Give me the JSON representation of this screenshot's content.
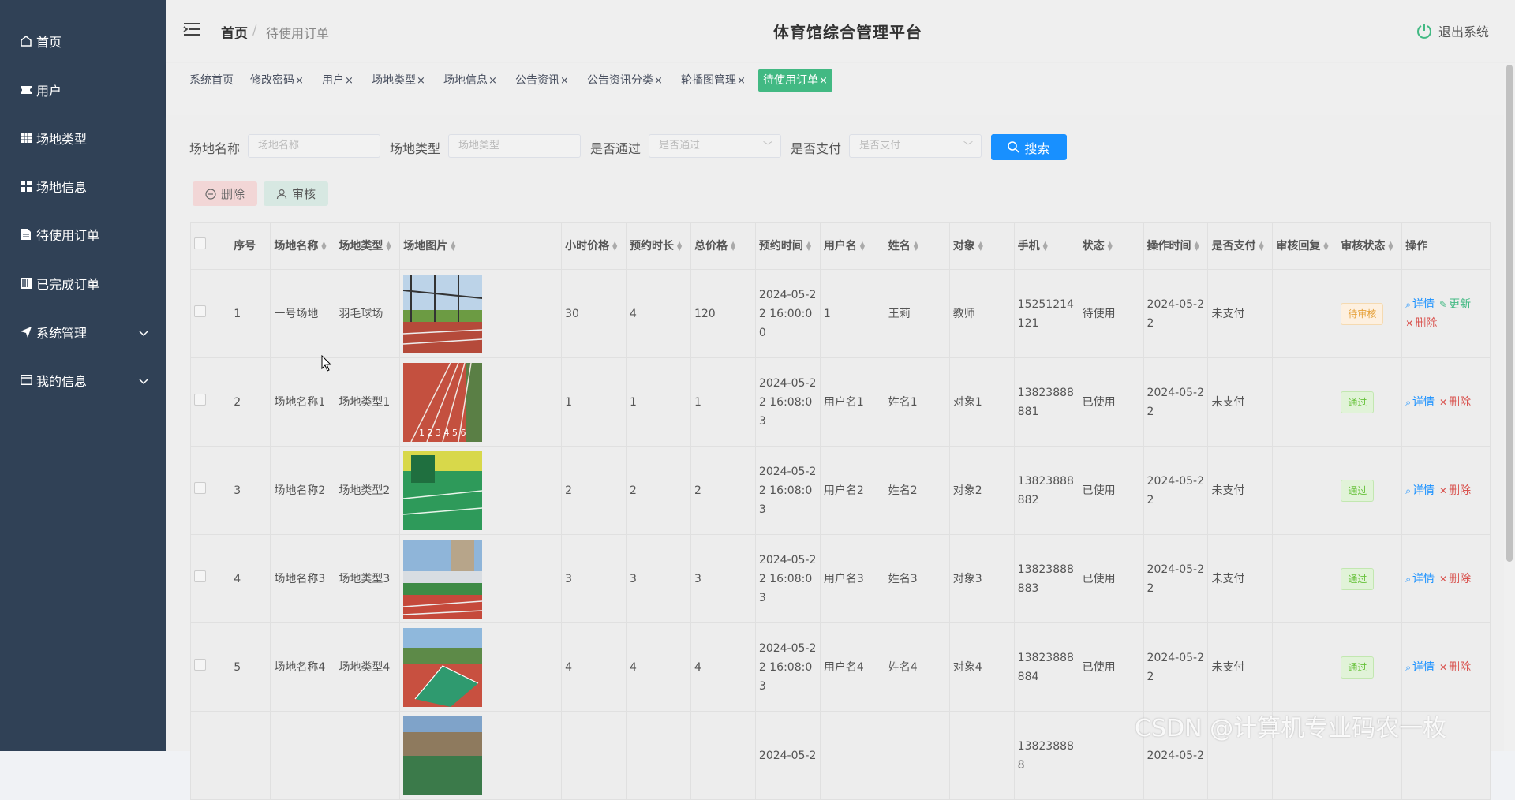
{
  "sidebar": {
    "items": [
      {
        "label": "首页",
        "icon": "home-icon"
      },
      {
        "label": "用户",
        "icon": "ticket-icon"
      },
      {
        "label": "场地类型",
        "icon": "table-icon"
      },
      {
        "label": "场地信息",
        "icon": "grid-icon"
      },
      {
        "label": "待使用订单",
        "icon": "file-icon"
      },
      {
        "label": "已完成订单",
        "icon": "book-icon"
      },
      {
        "label": "系统管理",
        "icon": "send-icon"
      },
      {
        "label": "我的信息",
        "icon": "card-icon"
      }
    ]
  },
  "header": {
    "breadcrumb_home": "首页",
    "breadcrumb_sep": "/",
    "breadcrumb_current": "待使用订单",
    "title": "体育馆综合管理平台",
    "logout": "退出系统"
  },
  "tags": [
    "系统首页",
    "修改密码",
    "用户",
    "场地类型",
    "场地信息",
    "公告资讯",
    "公告资讯分类",
    "轮播图管理",
    "待使用订单"
  ],
  "tag_close": "×",
  "search": {
    "venue_name_label": "场地名称",
    "venue_name_placeholder": "场地名称",
    "venue_type_label": "场地类型",
    "venue_type_placeholder": "场地类型",
    "passed_label": "是否通过",
    "passed_placeholder": "是否通过",
    "paid_label": "是否支付",
    "paid_placeholder": "是否支付",
    "search_button": "搜索"
  },
  "actions": {
    "delete": "删除",
    "audit": "审核"
  },
  "table": {
    "columns": [
      "序号",
      "场地名称",
      "场地类型",
      "场地图片",
      "小时价格",
      "预约时长",
      "总价格",
      "预约时间",
      "用户名",
      "姓名",
      "对象",
      "手机",
      "状态",
      "操作时间",
      "是否支付",
      "审核回复",
      "审核状态",
      "操作"
    ],
    "rows": [
      {
        "no": "1",
        "name": "一号场地",
        "type": "羽毛球场",
        "price": "30",
        "hours": "4",
        "total": "120",
        "time": "2024-05-22 16:00:00",
        "user": "1",
        "real": "王莉",
        "target": "教师",
        "phone": "15251214121",
        "status": "待使用",
        "optime": "2024-05-22",
        "paid": "未支付",
        "reply": "",
        "audit": "待审核",
        "audit_kind": "pending",
        "ops": [
          "详情",
          "更新",
          "删除"
        ]
      },
      {
        "no": "2",
        "name": "场地名称1",
        "type": "场地类型1",
        "price": "1",
        "hours": "1",
        "total": "1",
        "time": "2024-05-22 16:08:03",
        "user": "用户名1",
        "real": "姓名1",
        "target": "对象1",
        "phone": "13823888881",
        "status": "已使用",
        "optime": "2024-05-22",
        "paid": "未支付",
        "reply": "",
        "audit": "通过",
        "audit_kind": "pass",
        "ops": [
          "详情",
          "删除"
        ]
      },
      {
        "no": "3",
        "name": "场地名称2",
        "type": "场地类型2",
        "price": "2",
        "hours": "2",
        "total": "2",
        "time": "2024-05-22 16:08:03",
        "user": "用户名2",
        "real": "姓名2",
        "target": "对象2",
        "phone": "13823888882",
        "status": "已使用",
        "optime": "2024-05-22",
        "paid": "未支付",
        "reply": "",
        "audit": "通过",
        "audit_kind": "pass",
        "ops": [
          "详情",
          "删除"
        ]
      },
      {
        "no": "4",
        "name": "场地名称3",
        "type": "场地类型3",
        "price": "3",
        "hours": "3",
        "total": "3",
        "time": "2024-05-22 16:08:03",
        "user": "用户名3",
        "real": "姓名3",
        "target": "对象3",
        "phone": "13823888883",
        "status": "已使用",
        "optime": "2024-05-22",
        "paid": "未支付",
        "reply": "",
        "audit": "通过",
        "audit_kind": "pass",
        "ops": [
          "详情",
          "删除"
        ]
      },
      {
        "no": "5",
        "name": "场地名称4",
        "type": "场地类型4",
        "price": "4",
        "hours": "4",
        "total": "4",
        "time": "2024-05-22 16:08:03",
        "user": "用户名4",
        "real": "姓名4",
        "target": "对象4",
        "phone": "13823888884",
        "status": "已使用",
        "optime": "2024-05-22",
        "paid": "未支付",
        "reply": "",
        "audit": "通过",
        "audit_kind": "pass",
        "ops": [
          "详情",
          "删除"
        ]
      },
      {
        "no": "",
        "name": "",
        "type": "",
        "price": "",
        "hours": "",
        "total": "",
        "time": "2024-05-2",
        "user": "",
        "real": "",
        "target": "",
        "phone": "138238888",
        "status": "",
        "optime": "2024-05-2",
        "paid": "",
        "reply": "",
        "audit": "",
        "audit_kind": "pass",
        "ops": []
      }
    ]
  },
  "watermark": "CSDN @计算机专业码农一枚",
  "colors": {
    "sidebar": "#304156",
    "accent": "#42b983",
    "primary": "#1890ff"
  }
}
